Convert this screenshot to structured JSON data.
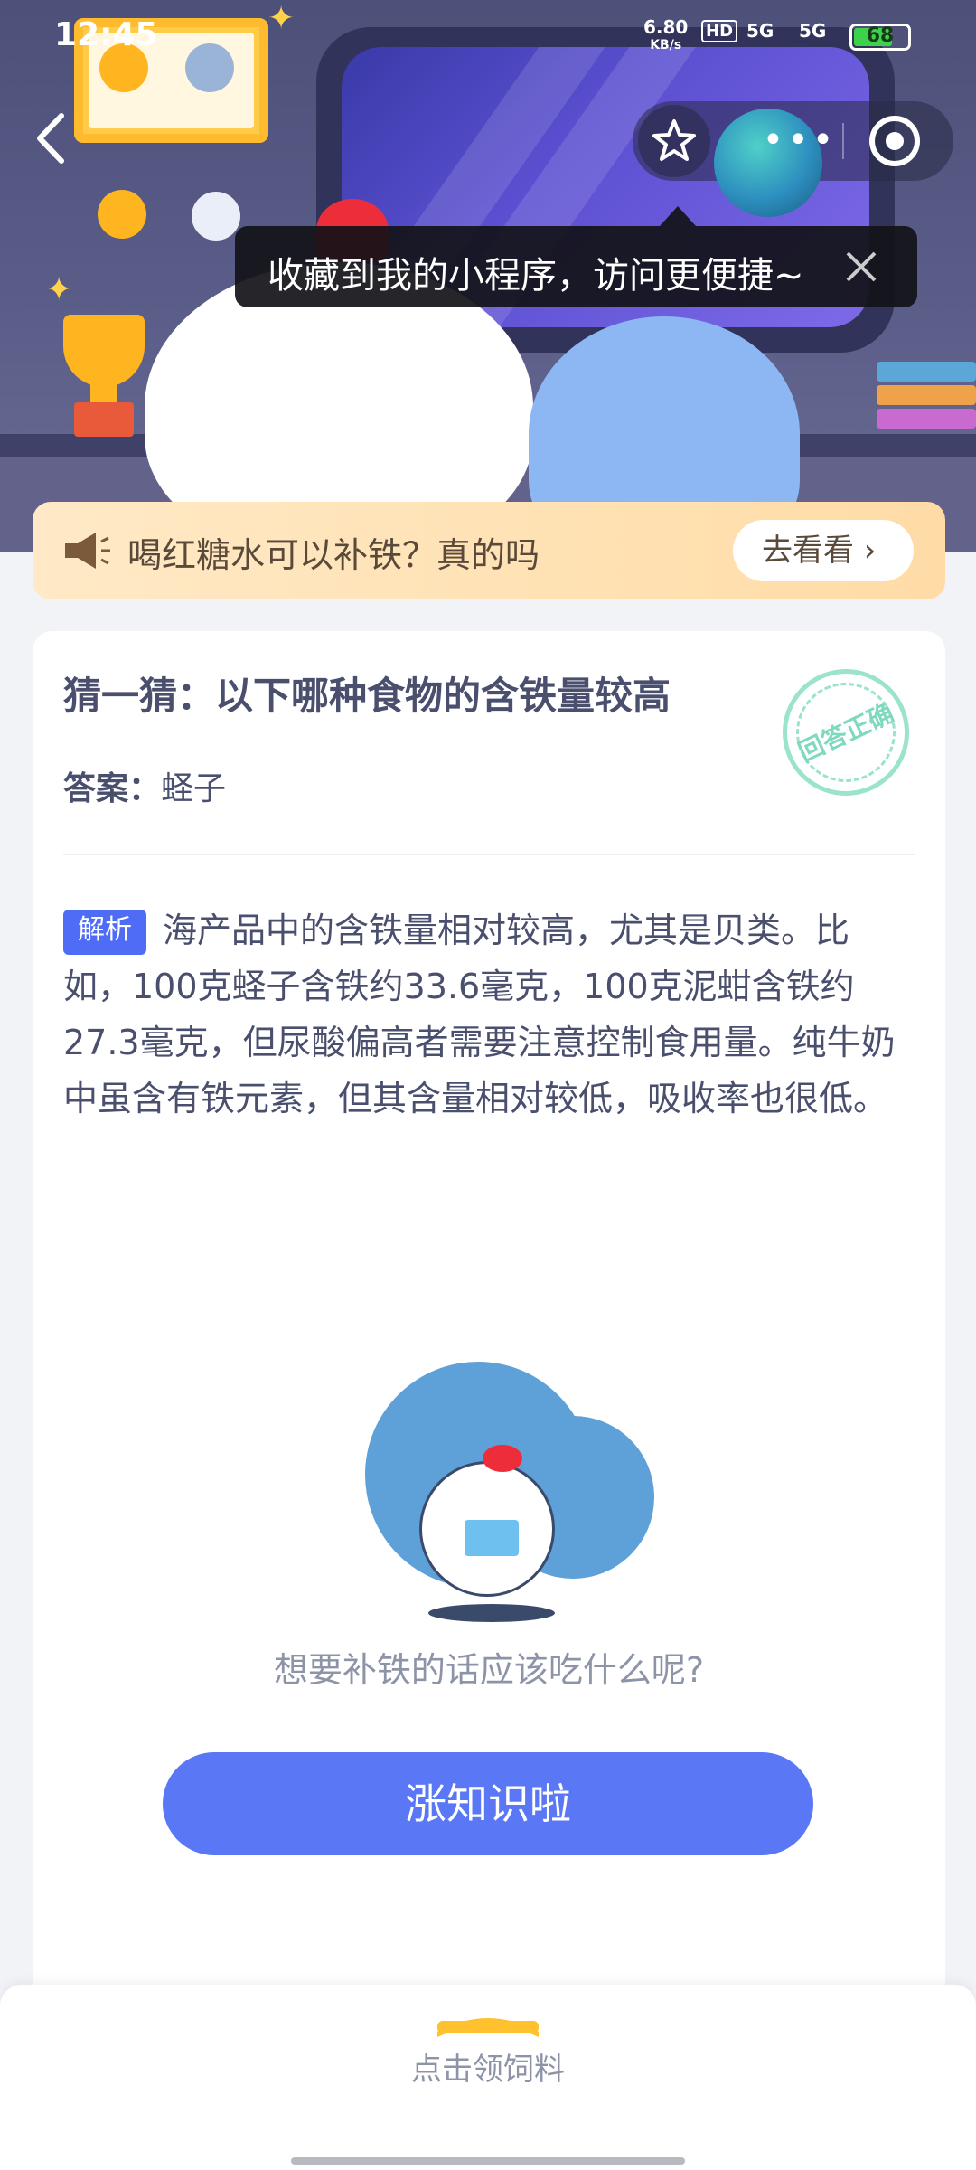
{
  "status_bar": {
    "time": "12:45",
    "net_speed": "6.80",
    "net_unit": "KB/s",
    "hd": "HD",
    "sig1": "5G",
    "sig2": "5G",
    "battery": "68",
    "battery_level": 0.68
  },
  "miniprogram": {
    "tooltip": "收藏到我的小程序，访问更便捷~"
  },
  "tip_banner": {
    "text": "喝红糖水可以补铁？真的吗",
    "button": "去看看 ›"
  },
  "question": {
    "title": "猜一猜：以下哪种食物的含铁量较高",
    "answer_label": "答案：",
    "answer_value": "蛏子",
    "stamp": "回答正确"
  },
  "analysis": {
    "tag": "解析",
    "text": "海产品中的含铁量相对较高，尤其是贝类。比如，100克蛏子含铁约33.6毫克，100克泥蚶含铁约27.3毫克，但尿酸偏高者需要注意控制食用量。纯牛奶中虽含有铁元素，但其含量相对较低，吸收率也很低。"
  },
  "promo": {
    "hint": "想要补铁的话应该吃什么呢?",
    "cta": "涨知识啦"
  },
  "bottom": {
    "feed_label": "点击领饲料"
  },
  "colors": {
    "accent": "#5a78f5",
    "tag": "#4e6cf5",
    "banner": "#ffe3b5",
    "stamp": "#9be3cd"
  }
}
